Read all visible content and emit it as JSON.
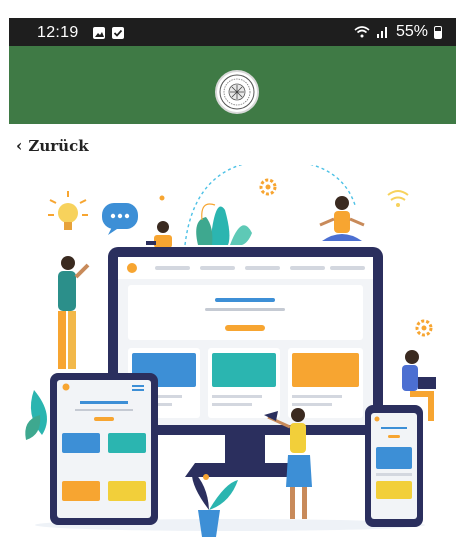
{
  "status_bar": {
    "time": "12:19",
    "signal_text": "55%"
  },
  "header": {
    "logo_name": "seal-logo",
    "color": "#3f7a45"
  },
  "nav": {
    "back_label": "Zurück"
  },
  "illustration": {
    "accent_colors": [
      "#2b2f5e",
      "#3d8fd6",
      "#2bb5b0",
      "#f7a531",
      "#4cc1e6",
      "#f2cf3a"
    ]
  }
}
